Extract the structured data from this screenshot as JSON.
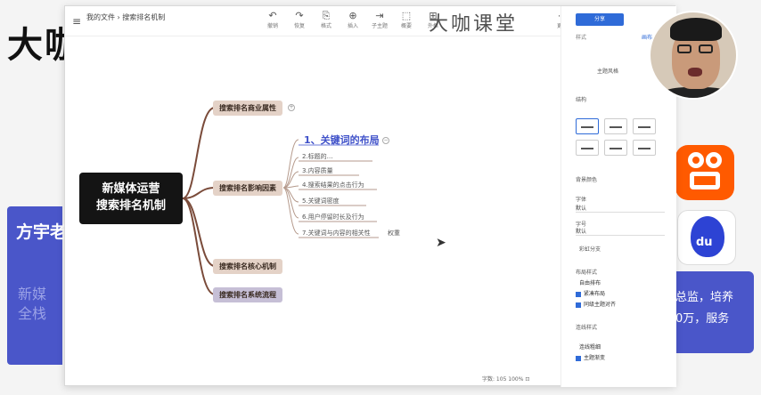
{
  "background": {
    "logo": "大咖",
    "card_name": "方宇老",
    "card_desc_line1": "新媒",
    "card_desc_line2": "全栈",
    "right_box_line1": "总监，培养",
    "right_box_line2": "0万，服务",
    "baidu_label": "du"
  },
  "window": {
    "breadcrumb": "我的文件 › 搜索排名机制",
    "watermark": "大咖课堂",
    "tools": [
      {
        "icon": "↶",
        "label": "撤销"
      },
      {
        "icon": "↷",
        "label": "恢复"
      },
      {
        "icon": "⎘",
        "label": "格式"
      },
      {
        "icon": "⊕",
        "label": "插入"
      },
      {
        "icon": "⇥",
        "label": "子主题"
      },
      {
        "icon": "⬚",
        "label": "概要"
      },
      {
        "icon": "⊞",
        "label": "外框"
      }
    ],
    "more_label": "更多"
  },
  "mindmap": {
    "root_line1": "新媒体运营",
    "root_line2": "搜索排名机制",
    "branches": [
      "搜索排名商业属性",
      "搜索排名影响因素",
      "搜索排名核心机制",
      "搜索排名系统流程"
    ],
    "subtitle": "1、关键词的布局",
    "leaves": [
      "2.标题的…",
      "3.内容质量",
      "4.搜索结果的点击行为",
      "5.关键词密度",
      "6.用户停留时长及行为",
      "7.关键词与内容的相关性"
    ],
    "leaf_tag": "权重"
  },
  "status": {
    "text": "字数: 105   100%   ⊡"
  },
  "panel": {
    "share_button": "分享",
    "tab_left": "样式",
    "tab_right": "画布",
    "theme_label": "主题风格",
    "structure_label": "结构",
    "bg_label": "背景颜色",
    "font_label": "字体",
    "font_value": "默认",
    "size_label": "字号",
    "size_value": "默认",
    "rainbow_label": "彩虹分支",
    "layout_label": "布局样式",
    "opt1": "自由排布",
    "opt2": "紧凑布局",
    "opt3": "同级主题对齐",
    "branch_label": "连线样式",
    "opt4": "连线粗细",
    "opt5": "主题渐变"
  }
}
